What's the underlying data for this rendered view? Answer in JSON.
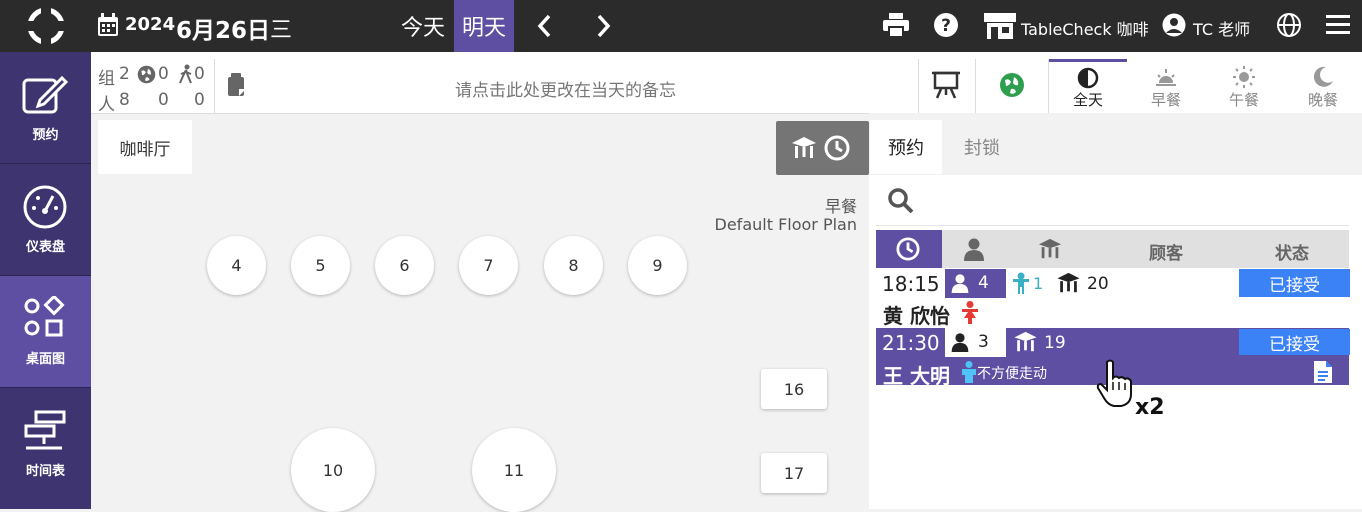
{
  "header": {
    "date_year": "2024",
    "date_month_day": "6月26日",
    "date_weekday": "三",
    "today_label": "今天",
    "tomorrow_label": "明天",
    "store_name": "TableCheck 咖啡",
    "user_name": "TC 老师"
  },
  "sidebar": {
    "items": [
      {
        "label": "预约",
        "icon": "edit-icon"
      },
      {
        "label": "仪表盘",
        "icon": "dashboard-icon"
      },
      {
        "label": "桌面图",
        "icon": "shapes-icon"
      },
      {
        "label": "时间表",
        "icon": "timeline-icon"
      }
    ],
    "active_index": 2
  },
  "stats": {
    "groups_label": "组",
    "groups_total": "2",
    "groups_web": "0",
    "groups_walkin": "0",
    "people_label": "人",
    "people_total": "8",
    "people_web": "0",
    "people_walkin": "0"
  },
  "memo": {
    "placeholder": "请点击此处更改在当天的备忘"
  },
  "meal_filters": [
    {
      "label": "全天",
      "icon": "half-circle-icon",
      "active": true
    },
    {
      "label": "早餐",
      "icon": "sunrise-icon",
      "active": false
    },
    {
      "label": "午餐",
      "icon": "sun-icon",
      "active": false
    },
    {
      "label": "晚餐",
      "icon": "moon-icon",
      "active": false
    }
  ],
  "floor": {
    "tab_label": "咖啡厅",
    "meal_label": "早餐",
    "plan_label": "Default Floor Plan",
    "tables_round_small": [
      "4",
      "5",
      "6",
      "7",
      "8",
      "9"
    ],
    "tables_round_large": [
      "10",
      "11"
    ],
    "tables_square": [
      "16",
      "17"
    ]
  },
  "panel": {
    "tab_reservations": "预约",
    "tab_block": "封锁",
    "col_guest": "顾客",
    "col_status": "状态",
    "reservations": [
      {
        "time": "18:15",
        "party": "4",
        "children": "1",
        "table": "20",
        "status": "已接受",
        "name": "黄 欣怡",
        "note": ""
      },
      {
        "time": "21:30",
        "party": "3",
        "children": "",
        "table": "19",
        "status": "已接受",
        "name": "王 大明",
        "note": "不方便走动"
      }
    ]
  },
  "cursor": {
    "click_count": "x2"
  },
  "colors": {
    "accent": "#5e4fa2",
    "sidebar": "#3d3470",
    "topbar": "#2b2b2b",
    "status_blue": "#3b82f6",
    "child_teal": "#3ab0c4",
    "female_red": "#e53935"
  }
}
